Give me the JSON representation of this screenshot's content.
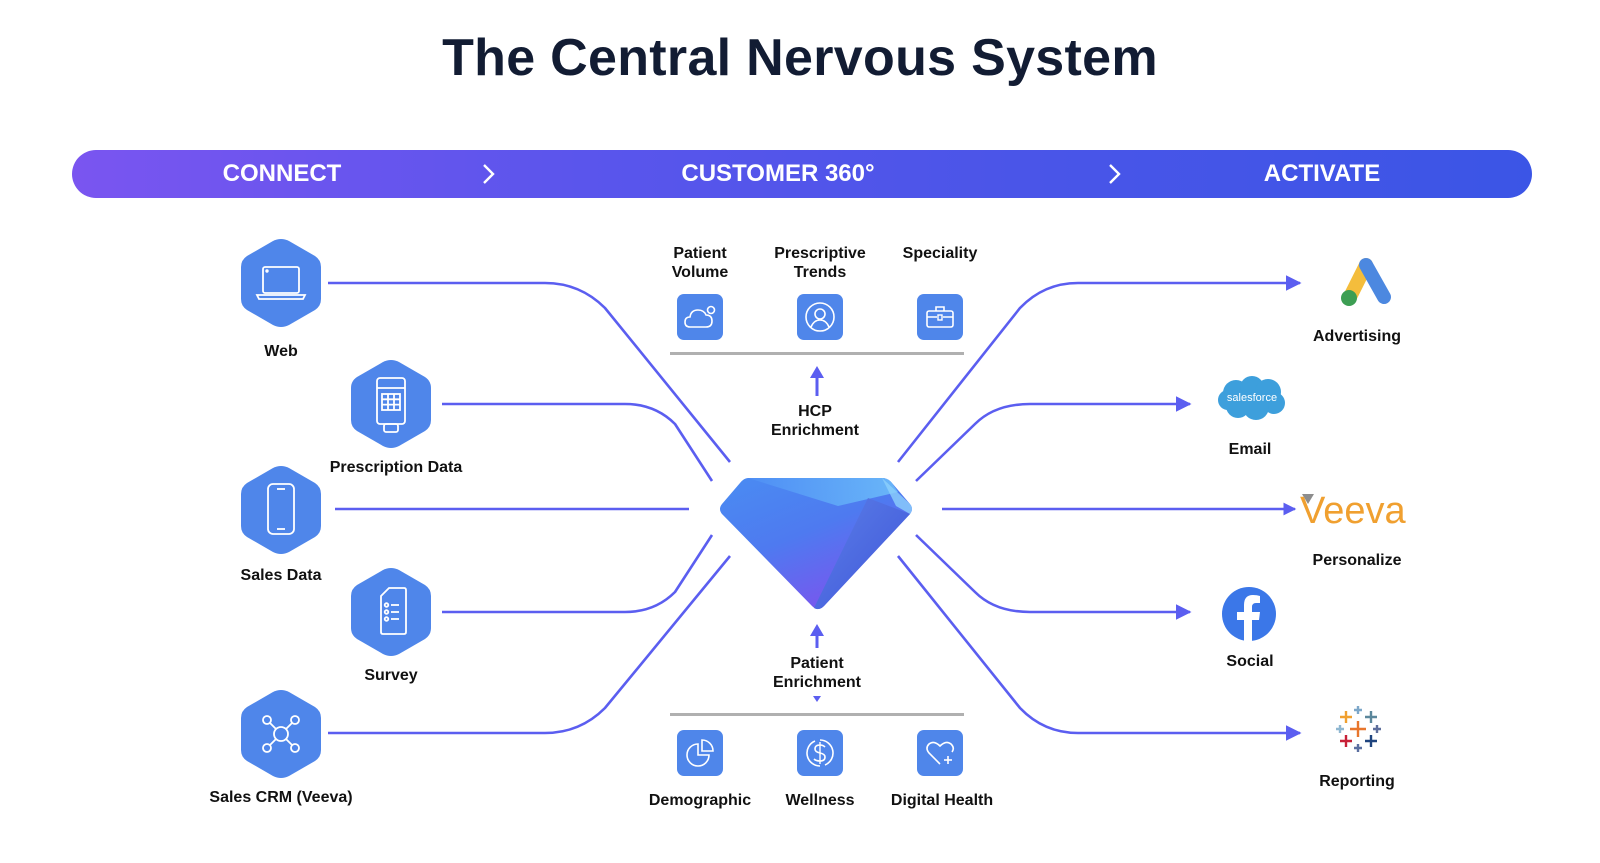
{
  "title": "The Central Nervous System",
  "band": {
    "stages": [
      "CONNECT",
      "CUSTOMER 360°",
      "ACTIVATE"
    ],
    "separator_icon": "chevron-right-icon"
  },
  "sources": [
    {
      "label": "Web",
      "icon": "laptop-icon"
    },
    {
      "label": "Prescription Data",
      "icon": "card-terminal-icon"
    },
    {
      "label": "Sales Data",
      "icon": "smartphone-icon"
    },
    {
      "label": "Survey",
      "icon": "checklist-document-icon"
    },
    {
      "label": "Sales CRM (Veeva)",
      "icon": "network-hub-icon"
    }
  ],
  "hcp": {
    "items": [
      {
        "label_line1": "Patient",
        "label_line2": "Volume",
        "icon": "cloud-icon"
      },
      {
        "label_line1": "Prescriptive",
        "label_line2": "Trends",
        "icon": "user-circle-icon"
      },
      {
        "label_line1": "Speciality",
        "label_line2": "",
        "icon": "briefcase-icon"
      }
    ],
    "enrichment_line1": "HCP",
    "enrichment_line2": "Enrichment"
  },
  "patient": {
    "enrichment_line1": "Patient",
    "enrichment_line2": "Enrichment",
    "items": [
      {
        "label": "Demographic",
        "icon": "pie-chart-icon"
      },
      {
        "label": "Wellness",
        "icon": "dollar-cycle-icon"
      },
      {
        "label": "Digital Health",
        "icon": "heart-plus-icon"
      }
    ]
  },
  "hub": {
    "icon": "diamond-gem-icon"
  },
  "destinations": [
    {
      "label": "Advertising",
      "logo": "google-ads-logo"
    },
    {
      "label": "Email",
      "logo": "salesforce-logo",
      "logo_text": "salesforce"
    },
    {
      "label": "Personalize",
      "logo": "veeva-logo",
      "logo_text": "Veeva"
    },
    {
      "label": "Social",
      "logo": "facebook-logo"
    },
    {
      "label": "Reporting",
      "logo": "tableau-logo"
    }
  ],
  "colors": {
    "band_start": "#7a55f0",
    "band_end": "#3b55e6",
    "wire": "#5b5ef0",
    "tile": "#4f86ea",
    "title": "#121c33",
    "veeva_orange": "#f0a030",
    "salesforce_blue": "#3d9fdc",
    "facebook_blue": "#3b77e8"
  }
}
